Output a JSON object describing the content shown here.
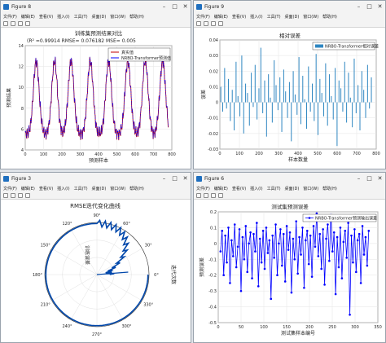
{
  "menu": [
    "文件(F)",
    "编辑(E)",
    "查看(V)",
    "插入(I)",
    "工具(T)",
    "桌面(D)",
    "窗口(W)",
    "帮助(H)"
  ],
  "windows": {
    "w8": {
      "title": "Figure 8"
    },
    "w9": {
      "title": "Figure 9"
    },
    "w3": {
      "title": "Figure 3"
    },
    "w6": {
      "title": "Figure 6"
    }
  },
  "colors": {
    "red": "#c00000",
    "navy": "#0000ff",
    "blue": "#0072bd",
    "bar": "#2e86c1"
  },
  "chart_data": [
    {
      "type": "line",
      "title": "训练集预测结果对比",
      "subtitle": "(R² =0.99914 RMSE= 0.076182 MSE= 0.005",
      "xlabel": "预测样本",
      "ylabel": "预测结果",
      "xlim": [
        0,
        800
      ],
      "ylim": [
        4,
        14
      ],
      "xticks": [
        0,
        100,
        200,
        300,
        400,
        500,
        600,
        700,
        800
      ],
      "yticks": [
        4,
        6,
        8,
        10,
        12,
        14
      ],
      "legend_position": "top-right",
      "series": [
        {
          "name": "真实值",
          "color": "#c00000"
        },
        {
          "name": "NRBO-Transformer预测值",
          "color": "#0000ff"
        }
      ],
      "peaks_x": [
        60,
        160,
        250,
        355,
        455,
        560,
        655,
        750
      ],
      "peak_level": 12.5,
      "trough_level": 5.5
    },
    {
      "type": "bar",
      "title": "相对误差",
      "xlabel": "样本数量",
      "ylabel": "误差",
      "xlim": [
        0,
        800
      ],
      "ylim": [
        -0.03,
        0.04
      ],
      "xticks": [
        0,
        100,
        200,
        300,
        400,
        500,
        600,
        700,
        800
      ],
      "yticks": [
        -0.03,
        -0.02,
        -0.01,
        0,
        0.01,
        0.02,
        0.03,
        0.04
      ],
      "legend": "NRBO-Transformer相对误差",
      "values": [
        0.01,
        -0.006,
        0.022,
        -0.004,
        0.015,
        -0.012,
        0.008,
        -0.018,
        0.026,
        0.004,
        -0.009,
        0.03,
        -0.02,
        0.012,
        0.006,
        -0.015,
        0.019,
        -0.003,
        0.024,
        -0.011,
        0.009,
        0.035,
        -0.007,
        0.014,
        -0.022,
        0.018,
        0.003,
        -0.013,
        0.027,
        0.011,
        -0.005,
        0.016,
        -0.019,
        0.021,
        0.007,
        -0.01,
        0.013,
        -0.025,
        0.02,
        0.005,
        -0.008,
        0.029,
        -0.014,
        0.017,
        0.002,
        -0.017,
        0.023,
        -0.006,
        0.012,
        -0.012,
        0.031,
        -0.021,
        0.015,
        0.006,
        -0.009,
        0.025,
        -0.015,
        0.018,
        0.004,
        -0.011,
        0.022,
        -0.028,
        0.014,
        0.009,
        -0.006,
        0.026,
        -0.013,
        0.019,
        0.003,
        -0.016,
        0.028,
        -0.007,
        0.011,
        -0.018,
        0.02,
        0.008,
        -0.01,
        0.024,
        -0.004,
        0.016
      ]
    },
    {
      "type": "polar",
      "title": "RMSE迭代变化曲线",
      "rlabel": "训练误差",
      "thetalabel": "迭代次数",
      "angle_ticks": [
        "0°",
        "30°",
        "60°",
        "90°",
        "120°",
        "150°",
        "180°",
        "210°",
        "240°",
        "270°",
        "300°",
        "330°"
      ]
    },
    {
      "type": "line",
      "title": "测试集预测误差",
      "xlabel": "测试集样本编号",
      "ylabel": "预测误差",
      "xlim": [
        0,
        350
      ],
      "ylim": [
        -0.5,
        0.2
      ],
      "xticks": [
        0,
        50,
        100,
        150,
        200,
        250,
        300,
        350
      ],
      "yticks": [
        -0.5,
        -0.4,
        -0.3,
        -0.2,
        -0.1,
        0,
        0.1,
        0.2
      ],
      "legend": "NRBO-Transformer预测输出误差",
      "values": [
        -0.05,
        0.08,
        -0.2,
        0.05,
        -0.12,
        0.1,
        -0.25,
        0.02,
        -0.08,
        0.12,
        -0.15,
        -0.02,
        0.09,
        -0.3,
        0.04,
        -0.1,
        0.11,
        -0.18,
        0.0,
        0.07,
        -0.22,
        0.06,
        -0.05,
        0.13,
        -0.27,
        0.03,
        -0.12,
        0.08,
        -0.16,
        0.1,
        -0.06,
        0.02,
        -0.35,
        0.05,
        -0.09,
        0.12,
        -0.2,
        0.0,
        0.09,
        -0.14,
        0.06,
        -0.24,
        0.11,
        -0.04,
        0.07,
        -0.31,
        0.03,
        -0.1,
        0.14,
        -0.19,
        0.04,
        -0.07,
        0.1,
        -0.28,
        0.02,
        0.08,
        -0.13,
        0.05,
        -0.21,
        0.11,
        -0.02,
        0.19,
        -0.08,
        0.06,
        -0.16,
        0.09,
        -0.26,
        0.03,
        0.12,
        -0.11,
        0.18,
        -0.05,
        0.07,
        -0.32,
        0.04,
        -0.15,
        0.1,
        -0.22,
        0.01,
        0.08,
        -0.09,
        0.13,
        -0.45,
        0.05,
        -0.12,
        0.09,
        -0.18,
        0.02,
        0.06,
        -0.25,
        0.11,
        -0.07,
        0.04,
        -0.14,
        0.08
      ]
    }
  ]
}
